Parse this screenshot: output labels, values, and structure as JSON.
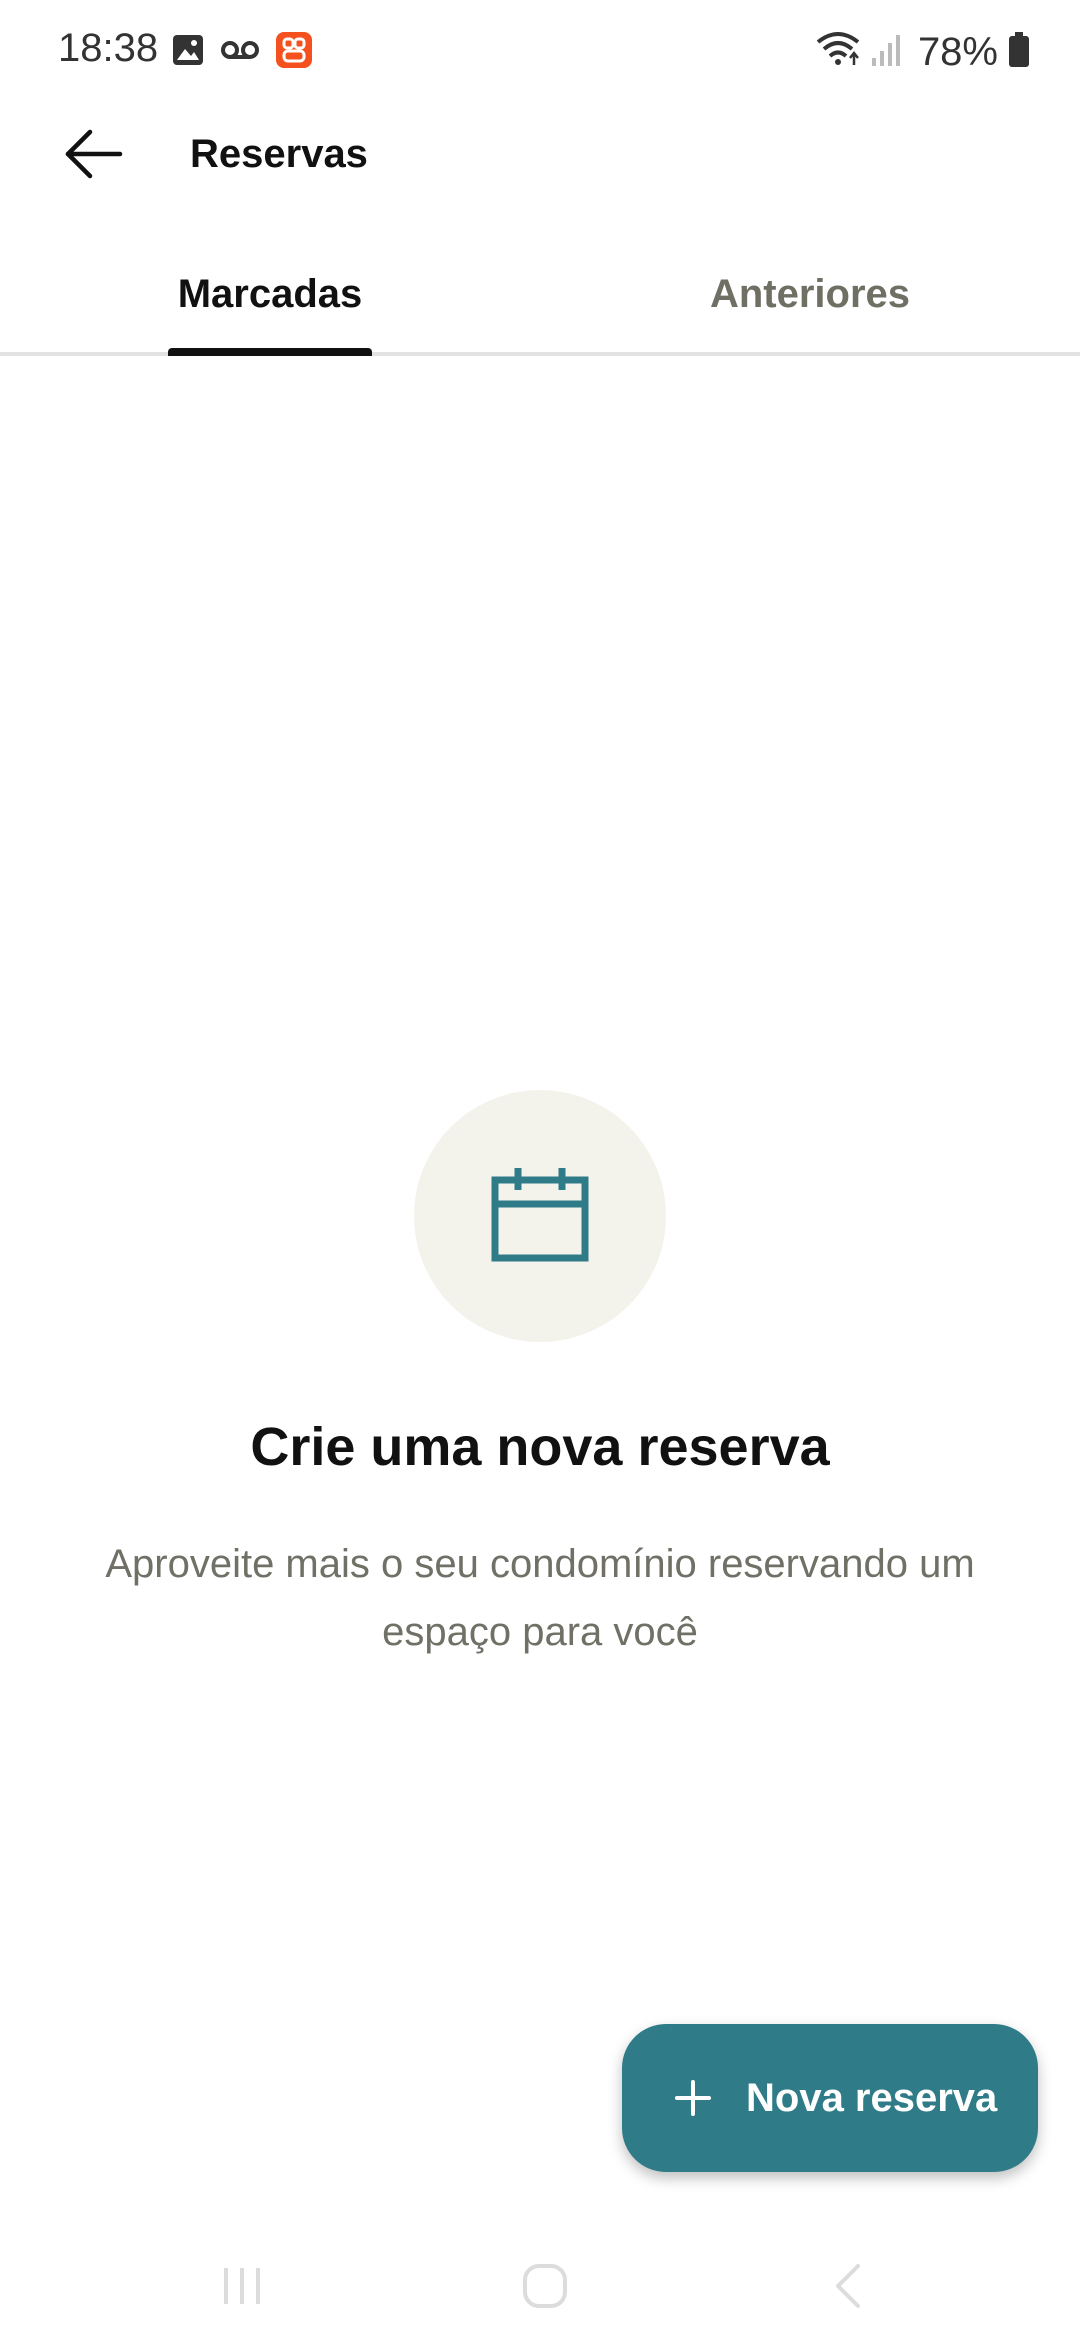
{
  "status_bar": {
    "time": "18:38",
    "battery": "78%",
    "left_icons": [
      "image-icon",
      "voicemail-icon",
      "app-notification-icon"
    ],
    "right_icons": [
      "wifi-icon",
      "signal-icon",
      "battery-icon"
    ]
  },
  "app_bar": {
    "title": "Reservas",
    "back_icon": "arrow-left-icon"
  },
  "tabs": [
    {
      "label": "Marcadas",
      "active": true
    },
    {
      "label": "Anteriores",
      "active": false
    }
  ],
  "empty_state": {
    "icon": "calendar-icon",
    "title": "Crie uma nova reserva",
    "description": "Aproveite mais o seu condomínio reservando um espaço para você"
  },
  "fab": {
    "icon": "plus-icon",
    "label": "Nova reserva"
  },
  "nav_bar": {
    "items": [
      "recent-apps-icon",
      "home-icon",
      "back-icon"
    ]
  },
  "colors": {
    "accent": "#2f7b87",
    "icon_circle_bg": "#f3f3ec",
    "muted_text": "#707066"
  }
}
